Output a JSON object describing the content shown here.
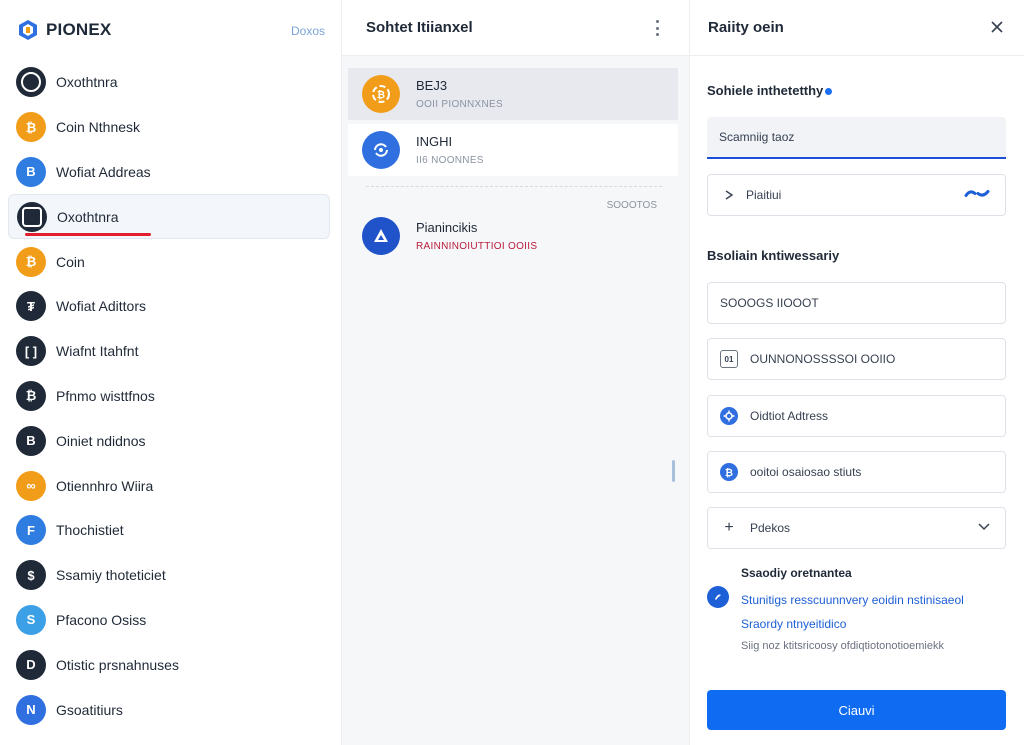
{
  "app": {
    "brand": "PIONEX",
    "brand_link": "Doxos"
  },
  "sidebar": {
    "items": [
      {
        "label": "Oxothtnra",
        "icon": "circle-coin-icon",
        "color": "#1f2937"
      },
      {
        "label": "Coin Nthnesk",
        "icon": "bitcoin-icon",
        "color": "#f29d1a"
      },
      {
        "label": "Wofiat Addreas",
        "icon": "wallet-coin-icon",
        "color": "#2f7de1"
      },
      {
        "label": "Oxothtnra",
        "icon": "monitor-coin-icon",
        "color": "#1f2937",
        "active": true
      },
      {
        "label": "Coin",
        "icon": "bitcoin-icon",
        "color": "#f29d1a"
      },
      {
        "label": "Wofiat Adittors",
        "icon": "tether-icon",
        "color": "#1f2937"
      },
      {
        "label": "Wiafnt Itahfnt",
        "icon": "bracket-coin-icon",
        "color": "#1f2937"
      },
      {
        "label": "Pfnmo wisttfnos",
        "icon": "bitcoin-dark-icon",
        "color": "#1f2937"
      },
      {
        "label": "Oiniet ndidnos",
        "icon": "bitcoin-dark-icon",
        "color": "#1f2937"
      },
      {
        "label": "Otiennhro Wiira",
        "icon": "orange-coin-icon",
        "color": "#f29d1a"
      },
      {
        "label": "Thochistiet",
        "icon": "chain-coin-icon",
        "color": "#2f7de1"
      },
      {
        "label": "Ssamiy thoteticiet",
        "icon": "dollar-coin-icon",
        "color": "#1f2937"
      },
      {
        "label": "Pfacono Osiss",
        "icon": "cyan-coin-icon",
        "color": "#3ba0e6"
      },
      {
        "label": "Otistic prsnahnuses",
        "icon": "dark-coin-icon",
        "color": "#1f2937"
      },
      {
        "label": "Gsoatitiurs",
        "icon": "blue-coin-icon",
        "color": "#2f6fe0"
      }
    ]
  },
  "middle": {
    "title": "Sohtet Itiianxel",
    "rows": [
      {
        "name": "BEJ3",
        "sub": "OOII PIONNXNES",
        "icon": "bitcoin-icon",
        "color": "#f29d1a",
        "selected": true
      },
      {
        "name": "INGHI",
        "sub": "II6 NOONNES",
        "icon": "swap-coin-icon",
        "color": "#2f6fe0",
        "selected": false
      },
      {
        "name": "Pianincikis",
        "sub": "RAINNINOIUTTIOI OOIIS",
        "icon": "network-coin-icon",
        "color": "#2053c9",
        "selected": false
      }
    ],
    "caption": "SOOOTOS"
  },
  "panel": {
    "title": "Raiity oein",
    "section1_label": "Sohiele inthetetthy",
    "field_filled": "Scamniig taoz",
    "field_link": "Piaitiui",
    "section2_label": "Bsoliain kntiwessariy",
    "field_plain": "SOOOGS IIOOOT",
    "field_code": "OUNNONOSSSSOI OOIIO",
    "field_address": "Oidtiot Adtress",
    "field_extra": "ooitoi osaiosao stiuts",
    "field_select": "Pdekos",
    "info_title": "Ssaodiy oretnantea",
    "info_link1": "Stunitigs resscuunnvery eoidin nstinisaeol",
    "info_link2": "Sraordy ntnyeitidico",
    "info_note": "Siig noz ktitsricoosy ofdiqtiotonotioemiekk",
    "submit_label": "Ciauvi"
  }
}
